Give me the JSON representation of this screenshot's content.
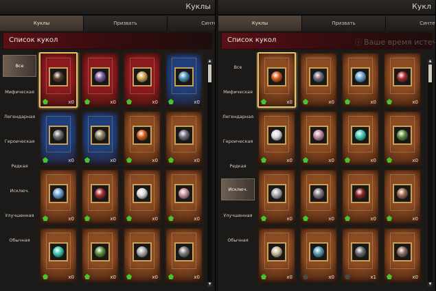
{
  "panels": [
    {
      "title": "Куклы",
      "tabs": [
        {
          "label": "Куклы",
          "active": true
        },
        {
          "label": "Призвать",
          "active": false
        },
        {
          "label": "Синте",
          "active": false
        }
      ],
      "list_title": "Список кукол",
      "header_note": "",
      "categories": [
        {
          "label": "Все",
          "active": true
        },
        {
          "label": "Мифическая",
          "active": false
        },
        {
          "label": "Легендарная",
          "active": false
        },
        {
          "label": "Героическая",
          "active": false
        },
        {
          "label": "Редкая",
          "active": false
        },
        {
          "label": "Исключ.",
          "active": false
        },
        {
          "label": "Улучшенная",
          "active": false
        },
        {
          "label": "Обычная",
          "active": false
        }
      ],
      "cards": [
        {
          "bg": "#8b1a1f",
          "portrait": "#5a3a2a",
          "count": "x0",
          "selected": true,
          "gem": "green"
        },
        {
          "bg": "#8b1a1f",
          "portrait": "#7b5a9a",
          "count": "x0",
          "selected": false,
          "gem": "green"
        },
        {
          "bg": "#8b1a1f",
          "portrait": "#c9a24a",
          "count": "x0",
          "selected": false,
          "gem": "green"
        },
        {
          "bg": "#1f3f7a",
          "portrait": "#4a8ab0",
          "count": "x0",
          "selected": false,
          "gem": "green"
        },
        {
          "bg": "#1f3f7a",
          "portrait": "#6a6a72",
          "count": "x0",
          "selected": false,
          "gem": "green"
        },
        {
          "bg": "#1f3f7a",
          "portrait": "#8a7a5a",
          "count": "x0",
          "selected": false,
          "gem": "green"
        },
        {
          "bg": "#8a4a22",
          "portrait": "#d25a1a",
          "count": "x0",
          "selected": false,
          "gem": "green"
        },
        {
          "bg": "#8a4a22",
          "portrait": "#6a6a7a",
          "count": "x0",
          "selected": false,
          "gem": "green"
        },
        {
          "bg": "#8a4a22",
          "portrait": "#6aa0d0",
          "count": "x0",
          "selected": false,
          "gem": "green"
        },
        {
          "bg": "#8a4a22",
          "portrait": "#a02a2a",
          "count": "x0",
          "selected": false,
          "gem": "green"
        },
        {
          "bg": "#8a4a22",
          "portrait": "#d8d8d8",
          "count": "x0",
          "selected": false,
          "gem": "green"
        },
        {
          "bg": "#8a4a22",
          "portrait": "#c08a9a",
          "count": "x0",
          "selected": false,
          "gem": "green"
        },
        {
          "bg": "#8a4a22",
          "portrait": "#3ac8b0",
          "count": "x0",
          "selected": false,
          "gem": "green"
        },
        {
          "bg": "#8a4a22",
          "portrait": "#5a8a3a",
          "count": "x0",
          "selected": false,
          "gem": "green"
        },
        {
          "bg": "#8a4a22",
          "portrait": "#a8a8a8",
          "count": "x0",
          "selected": false,
          "gem": "green"
        },
        {
          "bg": "#8a4a22",
          "portrait": "#7a7a7a",
          "count": "x0",
          "selected": false,
          "gem": "green"
        }
      ]
    },
    {
      "title": "Кукл",
      "tabs": [
        {
          "label": "Куклы",
          "active": true
        },
        {
          "label": "Призвать",
          "active": false
        },
        {
          "label": "Синте",
          "active": false
        }
      ],
      "list_title": "Список кукол",
      "header_note": "Ваше время истеч",
      "categories": [
        {
          "label": "Все",
          "active": false
        },
        {
          "label": "Мифическая",
          "active": false
        },
        {
          "label": "Легендарная",
          "active": false
        },
        {
          "label": "Героическая",
          "active": false
        },
        {
          "label": "Редкая",
          "active": false
        },
        {
          "label": "Исключ.",
          "active": true
        },
        {
          "label": "Улучшенная",
          "active": false
        },
        {
          "label": "Обычная",
          "active": false
        }
      ],
      "cards": [
        {
          "bg": "#8a4a22",
          "portrait": "#d25a1a",
          "count": "x0",
          "selected": true,
          "gem": "green"
        },
        {
          "bg": "#8a4a22",
          "portrait": "#6a6a7a",
          "count": "x0",
          "selected": false,
          "gem": "green"
        },
        {
          "bg": "#8a4a22",
          "portrait": "#6aa0d0",
          "count": "x0",
          "selected": false,
          "gem": "green"
        },
        {
          "bg": "#8a4a22",
          "portrait": "#a02a2a",
          "count": "x0",
          "selected": false,
          "gem": "green"
        },
        {
          "bg": "#8a4a22",
          "portrait": "#d8d8d8",
          "count": "x0",
          "selected": false,
          "gem": "green"
        },
        {
          "bg": "#8a4a22",
          "portrait": "#c08a9a",
          "count": "x0",
          "selected": false,
          "gem": "green"
        },
        {
          "bg": "#8a4a22",
          "portrait": "#3ac8b0",
          "count": "x0",
          "selected": false,
          "gem": "green"
        },
        {
          "bg": "#8a4a22",
          "portrait": "#5a8a3a",
          "count": "x0",
          "selected": false,
          "gem": "green"
        },
        {
          "bg": "#8a4a22",
          "portrait": "#a8a8a8",
          "count": "x0",
          "selected": false,
          "gem": "green"
        },
        {
          "bg": "#8a4a22",
          "portrait": "#7a7a7a",
          "count": "x0",
          "selected": false,
          "gem": "green"
        },
        {
          "bg": "#8a4a22",
          "portrait": "#8a2020",
          "count": "x0",
          "selected": false,
          "gem": "green"
        },
        {
          "bg": "#8a4a22",
          "portrait": "#9a6a4a",
          "count": "x0",
          "selected": false,
          "gem": "green"
        },
        {
          "bg": "#8a4a22",
          "portrait": "#c8b89a",
          "count": "x0",
          "selected": false,
          "gem": "green"
        },
        {
          "bg": "#8a4a22",
          "portrait": "#5a9ab0",
          "count": "x0",
          "selected": false,
          "gem": "dim"
        },
        {
          "bg": "#8a4a22",
          "portrait": "#6a6a6a",
          "count": "x1",
          "selected": false,
          "gem": "dim"
        },
        {
          "bg": "#8a4a22",
          "portrait": "#8a6a5a",
          "count": "x0",
          "selected": false,
          "gem": "green"
        }
      ]
    }
  ]
}
